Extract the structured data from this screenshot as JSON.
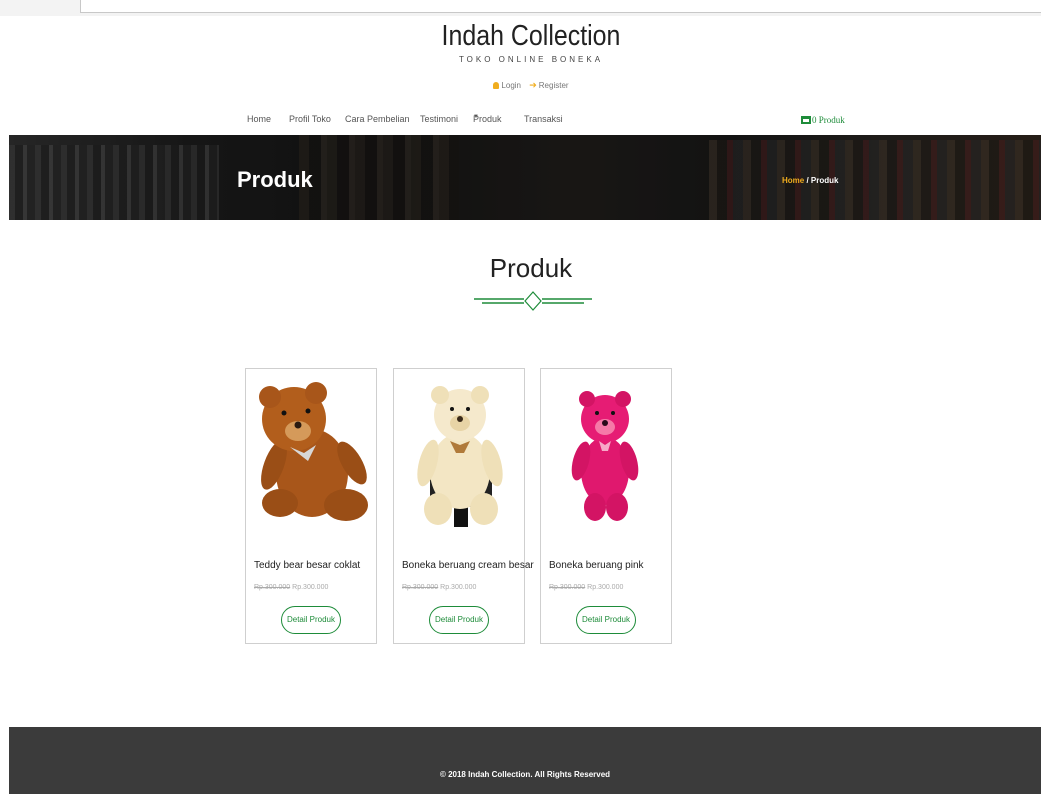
{
  "header": {
    "brand_title": "Indah Collection",
    "brand_subtitle": "TOKO ONLINE BONEKA",
    "login_label": "Login",
    "register_label": "Register"
  },
  "nav": {
    "items": [
      "Home",
      "Profil Toko",
      "Cara Pembelian",
      "Testimoni",
      "Produk",
      "Transaksi"
    ],
    "cart_label": "0 Produk"
  },
  "banner": {
    "title": "Produk",
    "breadcrumb_home": "Home",
    "breadcrumb_separator": " / ",
    "breadcrumb_current": "Produk"
  },
  "section": {
    "title": "Produk"
  },
  "products": [
    {
      "name": "Teddy bear besar coklat",
      "old_price": "Rp.300.000",
      "price": "Rp.300.000",
      "button": "Detail Produk",
      "color": "#a8561a"
    },
    {
      "name": "Boneka beruang cream besar",
      "old_price": "Rp.300.000",
      "price": "Rp.300.000",
      "button": "Detail Produk",
      "color": "#f3e6c4"
    },
    {
      "name": "Boneka beruang pink",
      "old_price": "Rp.300.000",
      "price": "Rp.300.000",
      "button": "Detail Produk",
      "color": "#e0186e"
    }
  ],
  "footer": {
    "text": "© 2018 Indah Collection. All Rights Reserved"
  },
  "colors": {
    "accent": "#1e8c3a",
    "highlight": "#f0ad1e",
    "footer_bg": "#3b3b3b"
  }
}
